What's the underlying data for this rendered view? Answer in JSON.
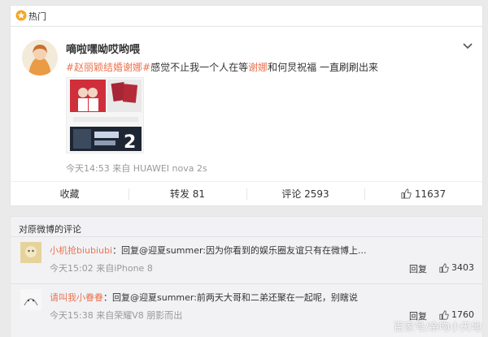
{
  "section": {
    "title": "热门"
  },
  "post": {
    "author": "嘀啦嘿呦哎哟喂",
    "tag1": "#赵丽颖结婚谢娜#",
    "text_a": "感觉不止我一个人在等",
    "mention": "谢娜",
    "text_b": "和何炅祝福 一直刷刷出来",
    "image_text": "2",
    "meta": "今天14:53 来自 HUAWEI nova 2s",
    "actions": {
      "favorite": "收藏",
      "repost": "转发 81",
      "comment": "评论 2593",
      "like": "11637"
    }
  },
  "comments": {
    "header": "对原微博的评论",
    "items": [
      {
        "user": "小机抢biubiubi",
        "text": "：回复@迎夏summer:因为你看到的娱乐圈友谊只有在微博上...",
        "time": "今天15:02 来自iPhone 8",
        "reply": "回复",
        "likes": "3403"
      },
      {
        "user": "请叫我小眷眷",
        "text": "：回复@迎夏summer:前两天大哥和二弟还聚在一起呢，别瞎说",
        "time": "今天15:38 来自荣耀V8 朋影而出",
        "reply": "回复",
        "likes": "1760"
      }
    ]
  },
  "watermark": "百家号/亲吻小天地",
  "colors": {
    "accent": "#eb7350",
    "meta": "#999999"
  }
}
